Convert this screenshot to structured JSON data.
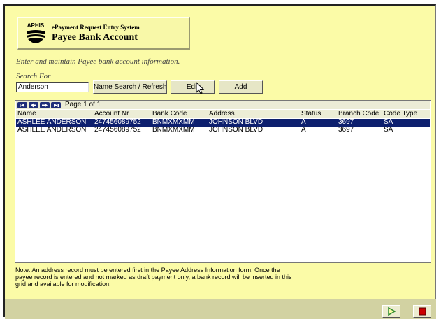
{
  "header": {
    "logo_text": "APHIS",
    "system_title": "ePayment Request Entry System",
    "page_title": "Payee Bank Account"
  },
  "subtitle": "Enter and maintain Payee bank account information.",
  "search": {
    "label": "Search For",
    "value": "Anderson"
  },
  "buttons": {
    "search_label": "Name Search / Refresh",
    "edit_label": "Edit",
    "add_label": "Add"
  },
  "grid": {
    "page_info": "Page 1 of 1",
    "columns": [
      "Name",
      "Account Nr",
      "Bank Code",
      "Address",
      "Status",
      "Branch Code",
      "Code Type"
    ],
    "rows": [
      [
        "ASHLEE ANDERSON",
        "247456089752",
        "BNMXMXMM",
        "JOHNSON BLVD",
        "A",
        "3697",
        "SA"
      ],
      [
        "ASHLEE ANDERSON",
        "247456089752",
        "BNMXMXMM",
        "JOHNSON BLVD",
        "A",
        "3697",
        "SA"
      ]
    ],
    "selected_row": 0
  },
  "note": "Note: An address record must be entered first in the Payee Address Information form. Once the payee record is entered and not marked as draft payment only, a bank record will be inserted in this grid and available for modification.",
  "footer": {
    "play_icon": "play-icon",
    "stop_icon": "stop-icon"
  },
  "colors": {
    "background": "#fbfba7",
    "selection": "#0d1f6e",
    "nav_button": "#1f2d7a",
    "stop_red": "#cc0000",
    "play_green": "#2a8a2a"
  }
}
